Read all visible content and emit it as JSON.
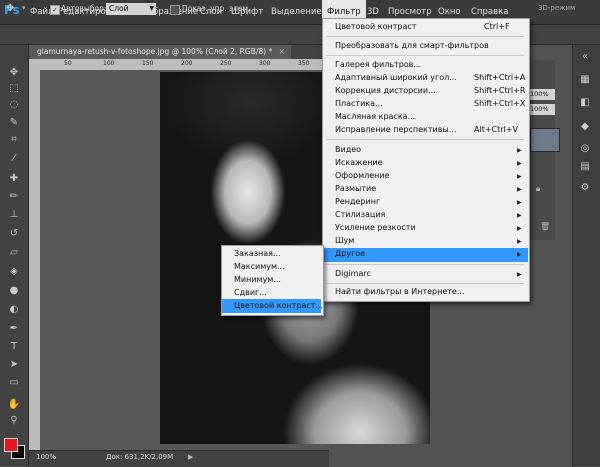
{
  "app": {
    "logo": "Ps"
  },
  "menubar": {
    "items": [
      "Файл",
      "Редактирование",
      "Изображение",
      "Слои",
      "Шрифт",
      "Выделение",
      "Фильтр",
      "3D",
      "Просмотр",
      "Окно",
      "Справка"
    ],
    "active": "Фильтр"
  },
  "options": {
    "autoselect_label": "Автовыбор:",
    "autoselect_value": "Слой",
    "show_controls_label": "Показ. упр. элем.",
    "mode_3d": "3D-режим"
  },
  "document": {
    "tab_title": "glamurnaya-retush-v-fotoshope.jpg @ 100% (Слой 2, RGB/8) *",
    "close": "×",
    "zoom": "100%",
    "doc_info": "Док: 631,2K/2,09M"
  },
  "ruler": {
    "ticks": [
      "50",
      "100",
      "150",
      "200",
      "250",
      "300",
      "350"
    ]
  },
  "layers_panel": {
    "opacity": "100%",
    "fill": "100%"
  },
  "colors": {
    "foreground": "#e8151e",
    "background": "#000000",
    "highlight": "#3399ff"
  },
  "filter_menu": {
    "items": [
      {
        "label": "Цветовой контраст",
        "shortcut": "Ctrl+F"
      },
      {
        "label": "Преобразовать для смарт-фильтров",
        "shortcut": ""
      },
      {
        "label": "Галерея фильтров...",
        "shortcut": ""
      },
      {
        "label": "Адаптивный широкий угол...",
        "shortcut": "Shift+Ctrl+A"
      },
      {
        "label": "Коррекция дисторсии...",
        "shortcut": "Shift+Ctrl+R"
      },
      {
        "label": "Пластика...",
        "shortcut": "Shift+Ctrl+X"
      },
      {
        "label": "Масляная краска...",
        "shortcut": ""
      },
      {
        "label": "Исправление перспективы...",
        "shortcut": "Alt+Ctrl+V"
      },
      {
        "label": "Видео",
        "shortcut": ""
      },
      {
        "label": "Искажение",
        "shortcut": ""
      },
      {
        "label": "Оформление",
        "shortcut": ""
      },
      {
        "label": "Размытие",
        "shortcut": ""
      },
      {
        "label": "Рендеринг",
        "shortcut": ""
      },
      {
        "label": "Стилизация",
        "shortcut": ""
      },
      {
        "label": "Усиление резкости",
        "shortcut": ""
      },
      {
        "label": "Шум",
        "shortcut": ""
      },
      {
        "label": "Другое",
        "shortcut": ""
      },
      {
        "label": "Digimarc",
        "shortcut": ""
      },
      {
        "label": "Найти фильтры в Интернете...",
        "shortcut": ""
      }
    ],
    "submenu_arrow": "▶"
  },
  "other_submenu": {
    "items": [
      "Заказная...",
      "Максимум...",
      "Минимум...",
      "Сдвиг...",
      "Цветовой контраст..."
    ],
    "selected": "Цветовой контраст..."
  },
  "icons": {
    "tools": [
      "move-icon",
      "marquee-icon",
      "lasso-icon",
      "quick-select-icon",
      "crop-icon",
      "eyedropper-icon",
      "healing-brush-icon",
      "brush-icon",
      "clone-stamp-icon",
      "history-brush-icon",
      "eraser-icon",
      "paint-bucket-icon",
      "blur-icon",
      "dodge-icon",
      "pen-icon",
      "type-icon",
      "path-select-icon",
      "shape-icon",
      "hand-icon",
      "zoom-icon"
    ]
  }
}
